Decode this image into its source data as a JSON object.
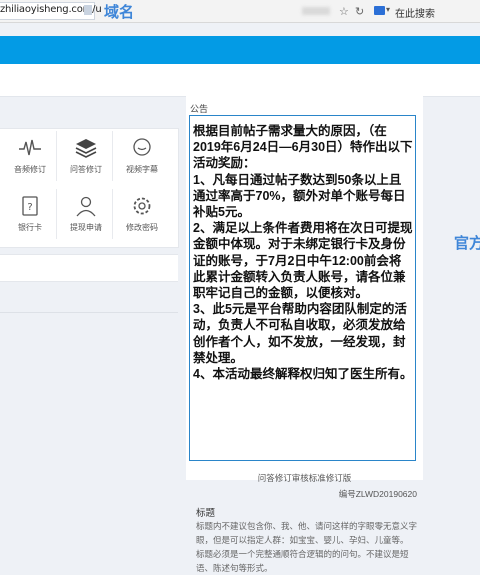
{
  "browser": {
    "url_partial": "zhiliaoyisheng.com/u",
    "annotation_domain": "域名",
    "search_label": "在此搜索",
    "icons": [
      "star-icon",
      "refresh-icon",
      "search-engine-icon"
    ]
  },
  "annotation_official": "官方",
  "colors": {
    "brand_blue": "#039be5",
    "annotation_blue": "#3f86d8",
    "box_border": "#2a85c9"
  },
  "menu": {
    "tiles": [
      {
        "label": "音频修订",
        "icon": "waveform-icon"
      },
      {
        "label": "问答修订",
        "icon": "layers-icon"
      },
      {
        "label": "视频字幕",
        "icon": "chat-bubble-icon"
      },
      {
        "label": "银行卡",
        "icon": "bank-card-icon"
      },
      {
        "label": "提现申请",
        "icon": "user-icon"
      },
      {
        "label": "修改密码",
        "icon": "gear-icon"
      }
    ]
  },
  "announcement": {
    "header": "公告",
    "lines": [
      "根据目前帖子需求量大的原因，（在2019年6月24日—6月30日）特作出以下活动奖励：",
      "1、凡每日通过帖子数达到50条以上且通过率高于70%，额外对单个账号每日补贴5元。",
      "2、满足以上条件者费用将在次日可提现金额中体现。对于未绑定银行卡及身份证的账号，于7月2日中午12:00前会将此累计金额转入负责人账号，请各位兼职牢记自己的金额，以便核对。",
      "3、此5元是平台帮助内容团队制定的活动，负责人不可私自收取，必须发放给创作者个人，如不发放，一经发现，封禁处理。",
      "4、本活动最终解释权归知了医生所有。"
    ]
  },
  "document": {
    "title": "问答修订审核标准修订版",
    "code": "编号ZLWD20190620",
    "section": "标题",
    "body": [
      "标题内不建议包含你、我、他、请问这样的字眼零无意义字",
      "眼，但是可以指定人群：如宝宝、婴儿、孕妇、儿童等。",
      "标题必须是一个完整通顺符合逻辑的的问句。不建议是短",
      "语、陈述句等形式。"
    ]
  }
}
